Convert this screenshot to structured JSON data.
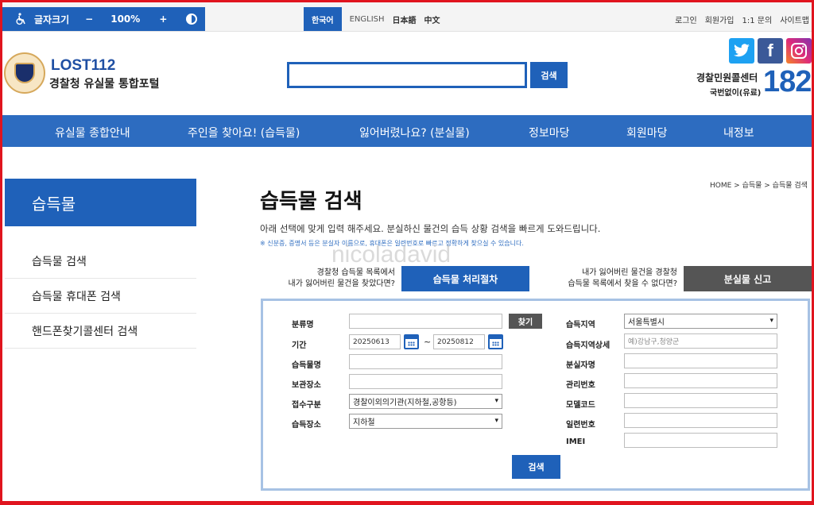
{
  "accessibility": {
    "font_size_label": "글자크기",
    "minus": "−",
    "zoom": "100%",
    "plus": "+"
  },
  "languages": {
    "active": "한국어",
    "others": [
      "ENGLISH",
      "日本語",
      "中文"
    ]
  },
  "utility_links": [
    "로그인",
    "회원가입",
    "1:1 문의",
    "사이트맵"
  ],
  "brand": {
    "title": "LOST112",
    "subtitle": "경찰청 유실물 통합포털"
  },
  "search": {
    "button": "검색",
    "value": ""
  },
  "social": {
    "twitter": "t",
    "facebook": "f",
    "instagram": "instagram-icon"
  },
  "call_center": {
    "title": "경찰민원콜센터",
    "sub": "국번없이(유료)",
    "number": "182"
  },
  "nav": [
    "유실물 종합안내",
    "주인을 찾아요! (습득물)",
    "잃어버렸나요? (분실물)",
    "정보마당",
    "회원마당",
    "내정보"
  ],
  "sidebar": {
    "heading": "습득물",
    "items": [
      "습득물 검색",
      "습득물 휴대폰 검색",
      "핸드폰찾기콜센터 검색"
    ]
  },
  "breadcrumb": "HOME > 습득물 > 습득물 검색",
  "page": {
    "title": "습득물 검색",
    "description": "아래 선택에 맞게 입력 해주세요. 분실하신 물건의 습득 상황 검색을 빠르게 도와드립니다.",
    "note": "※ 신분증, 증명서 등은 분실자 이름으로, 휴대폰은 일련번호로 빠르고 정확하게 찾으실 수 있습니다.",
    "watermark": "nicoladavid"
  },
  "cta": {
    "left_text_1": "경찰청 습득물 목록에서",
    "left_text_2": "내가 잃어버린 물건을 찾았다면?",
    "left_button": "습득물 처리절차",
    "right_text_1": "내가 잃어버린 물건을 경찰청",
    "right_text_2": "습득물 목록에서 찾을 수 없다면?",
    "right_button": "분실물 신고"
  },
  "form": {
    "category_label": "분류명",
    "find_button": "찾기",
    "period_label": "기간",
    "date_from": "20250613",
    "tilde": "~",
    "date_to": "20250812",
    "item_name_label": "습득물명",
    "storage_label": "보관장소",
    "receipt_type_label": "접수구분",
    "receipt_type_value": "경찰이외의기관(지하철,공항등)",
    "found_place_label": "습득장소",
    "found_place_value": "지하철",
    "region_label": "습득지역",
    "region_value": "서울특별시",
    "region_detail_label": "습득지역상세",
    "region_detail_placeholder": "예)강남구,청양군",
    "owner_label": "분실자명",
    "manage_no_label": "관리번호",
    "model_label": "모델코드",
    "serial_label": "일련번호",
    "imei_label": "IMEI",
    "submit": "검색"
  }
}
